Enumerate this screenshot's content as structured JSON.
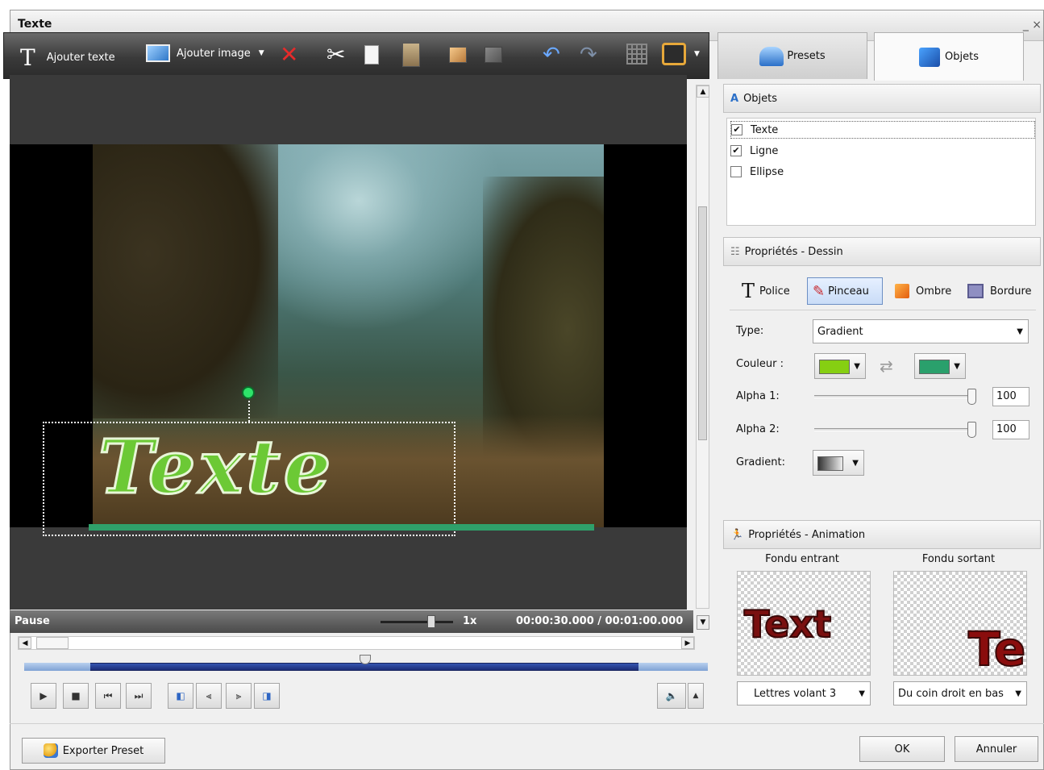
{
  "window": {
    "title": "Texte",
    "controls": "_ ×"
  },
  "toolbar": {
    "add_text_label": "Ajouter texte",
    "add_image_label": "Ajouter image"
  },
  "tabs": {
    "presets": "Presets",
    "objets": "Objets"
  },
  "preview": {
    "overlay_text": "Texte",
    "status": "Pause",
    "speed": "1x",
    "time": "00:00:30.000 / 00:01:00.000",
    "text_color": "#6cc935",
    "line_color": "#2fa06a"
  },
  "objects_panel": {
    "title": "Objets",
    "items": [
      {
        "label": "Texte",
        "checked": true
      },
      {
        "label": "Ligne",
        "checked": true
      },
      {
        "label": "Ellipse",
        "checked": false
      }
    ]
  },
  "drawing_props": {
    "title": "Propriétés - Dessin",
    "tabs": [
      "Police",
      "Pinceau",
      "Ombre",
      "Bordure"
    ],
    "active_tab": "Pinceau",
    "type_label": "Type:",
    "type_value": "Gradient",
    "color_label": "Couleur :",
    "color1": "#86cf12",
    "color2": "#2aa06c",
    "alpha1_label": "Alpha 1:",
    "alpha1_value": "100",
    "alpha2_label": "Alpha 2:",
    "alpha2_value": "100",
    "gradient_label": "Gradient:"
  },
  "animation_props": {
    "title": "Propriétés - Animation",
    "fade_in_title": "Fondu entrant",
    "fade_out_title": "Fondu sortant",
    "fade_in_preview": "Text",
    "fade_out_preview": "Te",
    "fade_in_value": "Lettres volant 3",
    "fade_out_value": "Du coin droit en bas"
  },
  "footer": {
    "export_label": "Exporter Preset",
    "ok_label": "OK",
    "cancel_label": "Annuler"
  }
}
